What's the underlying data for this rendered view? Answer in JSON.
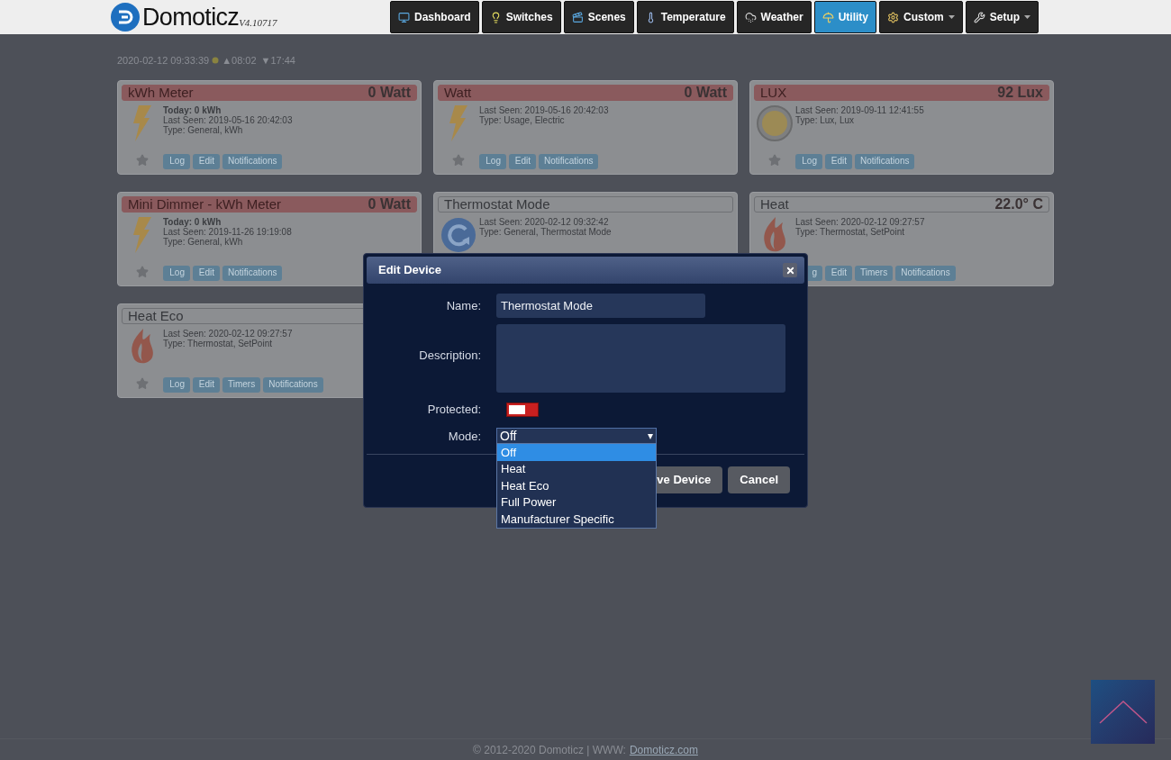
{
  "navbar": {
    "logo": "Domoticz",
    "version": "V4.10717",
    "items": [
      {
        "label": "Dashboard",
        "kind": "link",
        "selected": false
      },
      {
        "label": "Switches",
        "kind": "link",
        "selected": false
      },
      {
        "label": "Scenes",
        "kind": "link",
        "selected": false
      },
      {
        "label": "Temperature",
        "kind": "link",
        "selected": false
      },
      {
        "label": "Weather",
        "kind": "link",
        "selected": false
      },
      {
        "label": "Utility",
        "kind": "link",
        "selected": true
      },
      {
        "label": "Custom",
        "kind": "menu",
        "selected": false
      },
      {
        "label": "Setup",
        "kind": "menu",
        "selected": false
      }
    ]
  },
  "status": {
    "datetime": "2020-02-12 09:33:39",
    "sunrise": "▲08:02",
    "sunset": "▼17:44"
  },
  "cards": [
    {
      "name": "kWh Meter",
      "value": "0 Watt",
      "alert": true,
      "kind": "energy",
      "star": true,
      "lines": [
        {
          "text": "Today: 0 kWh",
          "kind": "bold"
        },
        {
          "text": "Last Seen: 2019-05-16 20:42:03",
          "kind": "plain"
        },
        {
          "text": "Type: General, kWh",
          "kind": "plain"
        }
      ],
      "buttons": [
        "Log",
        "Edit",
        "Notifications"
      ]
    },
    {
      "name": "Watt",
      "value": "0 Watt",
      "alert": true,
      "kind": "energy",
      "star": true,
      "lines": [
        {
          "text": "Last Seen: 2019-05-16 20:42:03",
          "kind": "plain"
        },
        {
          "text": "Type: Usage, Electric",
          "kind": "plain"
        }
      ],
      "buttons": [
        "Log",
        "Edit",
        "Notifications"
      ]
    },
    {
      "name": "LUX",
      "value": "92 Lux",
      "alert": true,
      "kind": "lux",
      "star": true,
      "lines": [
        {
          "text": "Last Seen: 2019-09-11 12:41:55",
          "kind": "plain"
        },
        {
          "text": "Type: Lux, Lux",
          "kind": "plain"
        }
      ],
      "buttons": [
        "Log",
        "Edit",
        "Notifications"
      ]
    },
    {
      "name": "Mini Dimmer - kWh Meter",
      "value": "0 Watt",
      "alert": true,
      "kind": "energy",
      "star": true,
      "lines": [
        {
          "text": "Today: 0 kWh",
          "kind": "bold"
        },
        {
          "text": "Last Seen: 2019-11-26 19:19:08",
          "kind": "plain"
        },
        {
          "text": "Type: General, kWh",
          "kind": "plain"
        }
      ],
      "buttons": [
        "Log",
        "Edit",
        "Notifications"
      ]
    },
    {
      "name": "Thermostat Mode",
      "alert": false,
      "kind": "mode",
      "star": false,
      "lines": [
        {
          "text": "Last Seen: 2020-02-12 09:32:42",
          "kind": "plain"
        },
        {
          "text": "Type: General, Thermostat Mode",
          "kind": "plain"
        }
      ]
    },
    {
      "name": "Heat",
      "value": "22.0° C",
      "alert": false,
      "kind": "setpoint",
      "star": false,
      "lines": [
        {
          "text": "Last Seen: 2020-02-12 09:27:57",
          "kind": "plain"
        },
        {
          "text": "Type: Thermostat, SetPoint",
          "kind": "plain"
        }
      ],
      "buttons": [
        "g",
        "Edit",
        "Timers",
        "Notifications"
      ]
    },
    {
      "name": "Heat Eco",
      "alert": false,
      "kind": "setpoint",
      "star": true,
      "lines": [
        {
          "text": "Last Seen: 2020-02-12 09:27:57",
          "kind": "plain"
        },
        {
          "text": "Type: Thermostat, SetPoint",
          "kind": "plain"
        }
      ],
      "buttons": [
        "Log",
        "Edit",
        "Timers",
        "Notifications"
      ]
    }
  ],
  "dialog": {
    "title": "Edit Device",
    "name_label": "Name:",
    "name_value": "Thermostat Mode",
    "description_label": "Description:",
    "protected_label": "Protected:",
    "protected": false,
    "mode_label": "Mode:",
    "mode_value": "Off",
    "mode_options": [
      {
        "label": "Off",
        "selected": true
      },
      {
        "label": "Heat",
        "selected": false
      },
      {
        "label": "Heat Eco",
        "selected": false
      },
      {
        "label": "Full Power",
        "selected": false
      },
      {
        "label": "Manufacturer Specific",
        "selected": false
      }
    ],
    "buttons": [
      "ve Device",
      "Cancel"
    ]
  },
  "footer": {
    "text": "© 2012-2020 Domoticz | WWW:",
    "link": "Domoticz.com"
  }
}
